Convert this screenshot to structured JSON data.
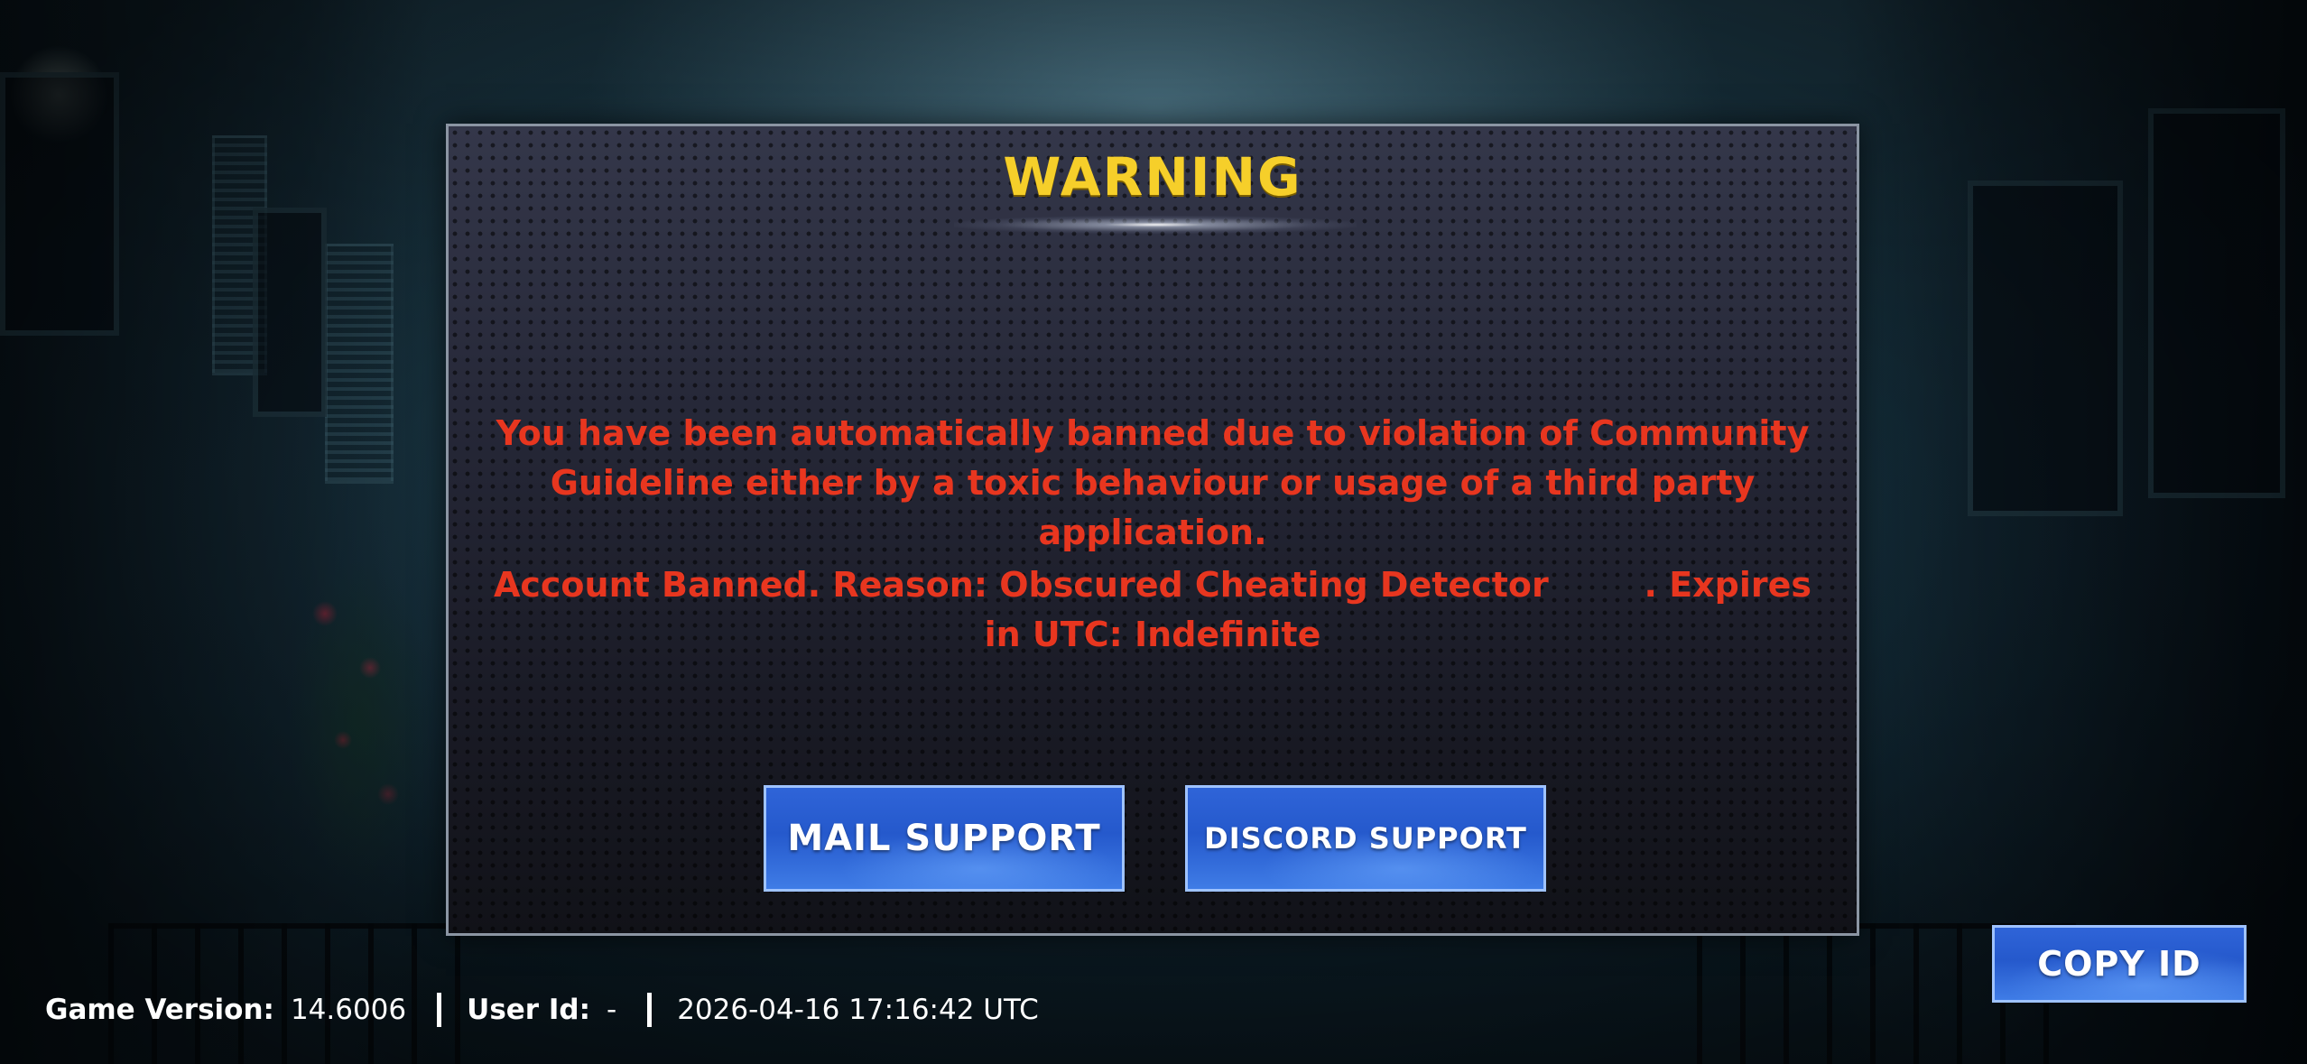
{
  "dialog": {
    "title": "WARNING",
    "message_line1": "You have been automatically banned due to violation of Community Guideline either by a toxic behaviour or usage of a third party application.",
    "message_line2": "Account Banned. Reason: Obscured Cheating Detector        . Expires in UTC: Indefinite",
    "mail_support_label": "MAIL SUPPORT",
    "discord_support_label": "DISCORD SUPPORT"
  },
  "footer": {
    "game_version_label": "Game Version:",
    "game_version_value": "14.6006",
    "user_id_label": "User Id:",
    "user_id_value": "-",
    "timestamp": "2026-04-16 17:16:42 UTC"
  },
  "copy_id_label": "COPY ID",
  "colors": {
    "title": "#f6cf2a",
    "message": "#e8361f",
    "button": "#2f64d8",
    "button_border": "#9fc3ff"
  }
}
